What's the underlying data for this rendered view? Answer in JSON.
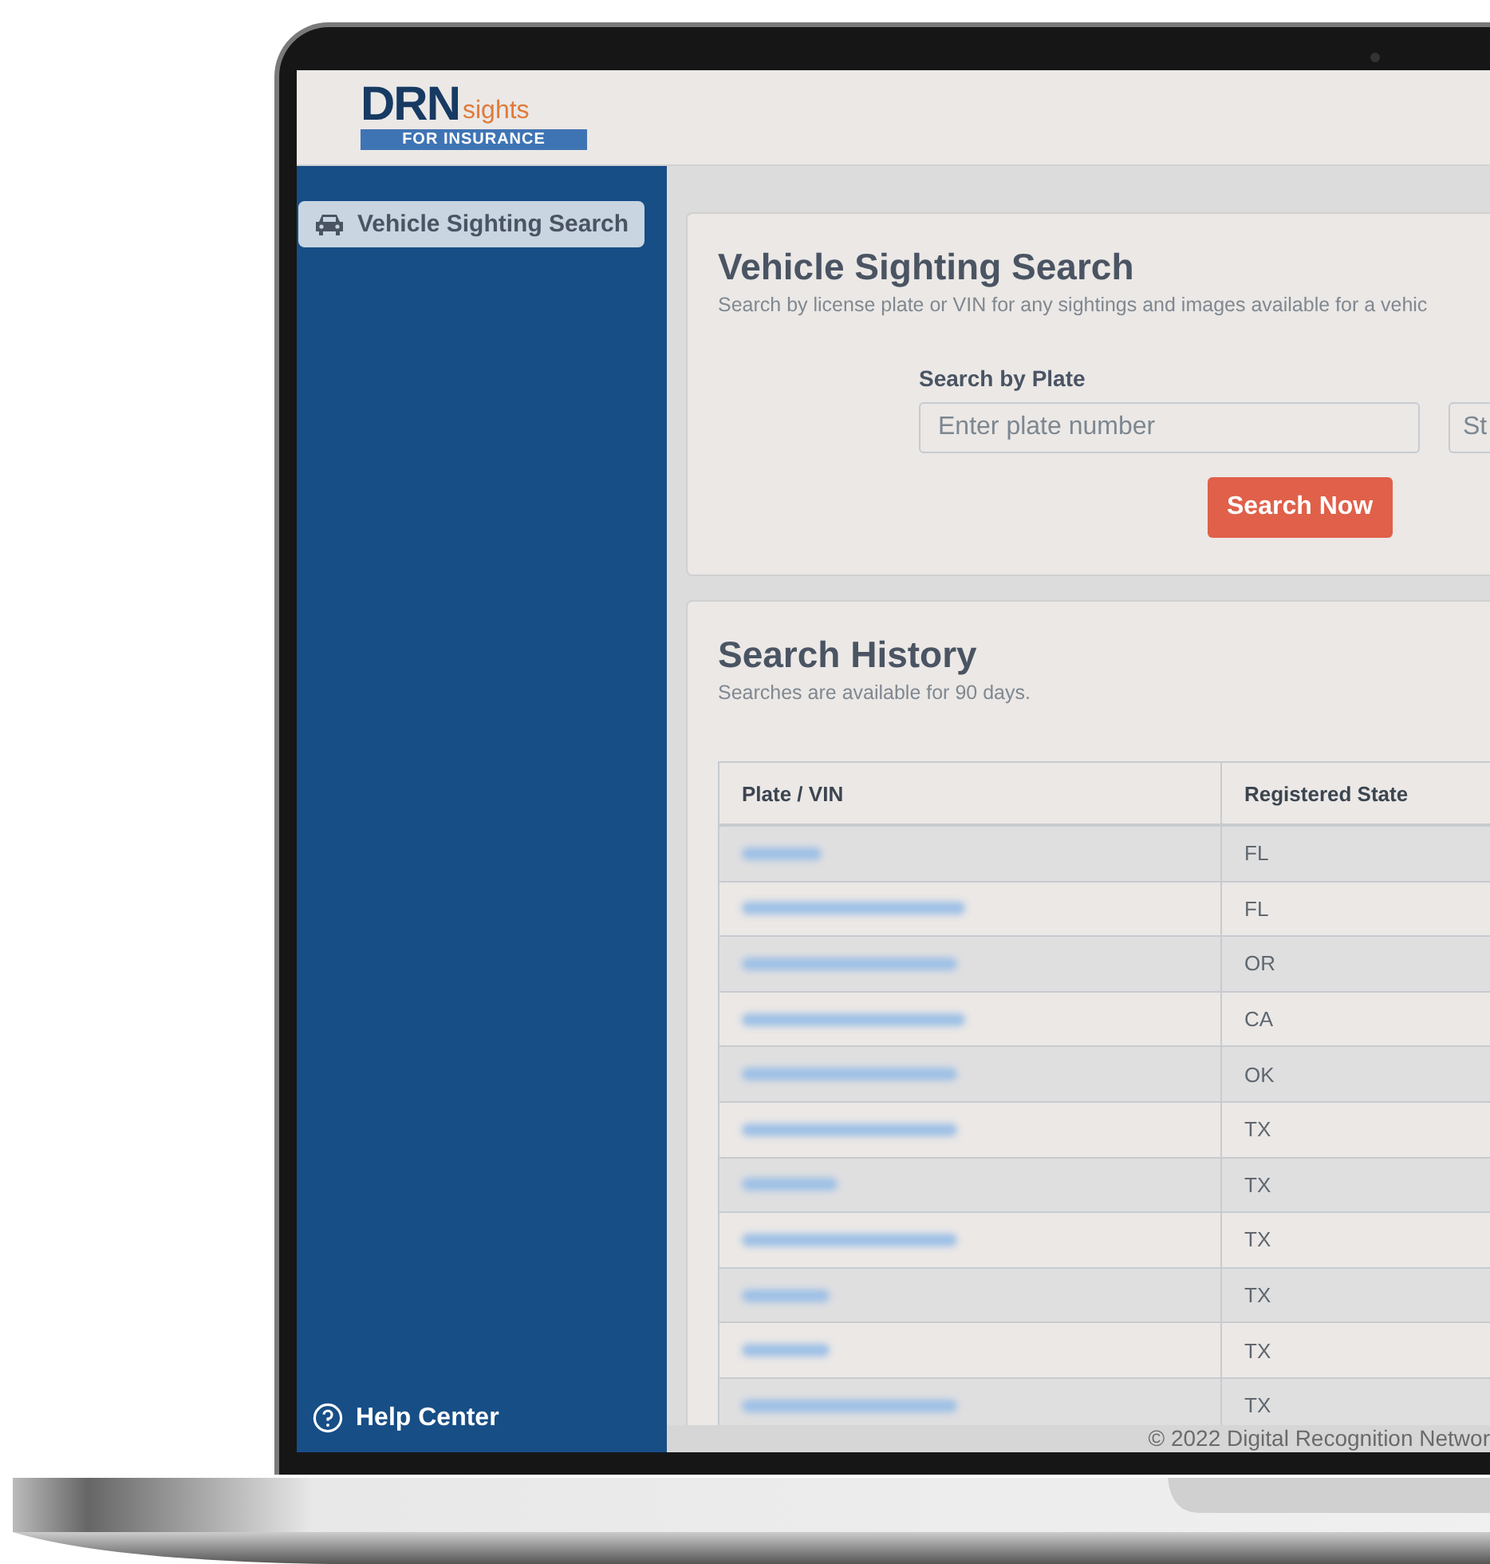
{
  "logo": {
    "brand": "DRN",
    "suffix": "sights",
    "tagline": "FOR INSURANCE"
  },
  "sidebar": {
    "items": [
      {
        "label": "Vehicle Sighting Search",
        "selected": true
      }
    ],
    "help": "Help Center"
  },
  "search_card": {
    "title": "Vehicle Sighting Search",
    "subtitle": "Search by license plate or VIN for any sightings and images available for a vehic",
    "plate_label": "Search by Plate",
    "plate_placeholder": "Enter plate number",
    "state_placeholder": "St",
    "button": "Search Now"
  },
  "history": {
    "title": "Search History",
    "subtitle": "Searches are available for 90 days.",
    "columns": [
      "Plate / VIN",
      "Registered State"
    ],
    "rows": [
      {
        "state": "FL"
      },
      {
        "state": "FL"
      },
      {
        "state": "OR"
      },
      {
        "state": "CA"
      },
      {
        "state": "OK"
      },
      {
        "state": "TX"
      },
      {
        "state": "TX"
      },
      {
        "state": "TX"
      },
      {
        "state": "TX"
      },
      {
        "state": "TX"
      },
      {
        "state": "TX"
      }
    ]
  },
  "footer": "© 2022 Digital Recognition Networ"
}
